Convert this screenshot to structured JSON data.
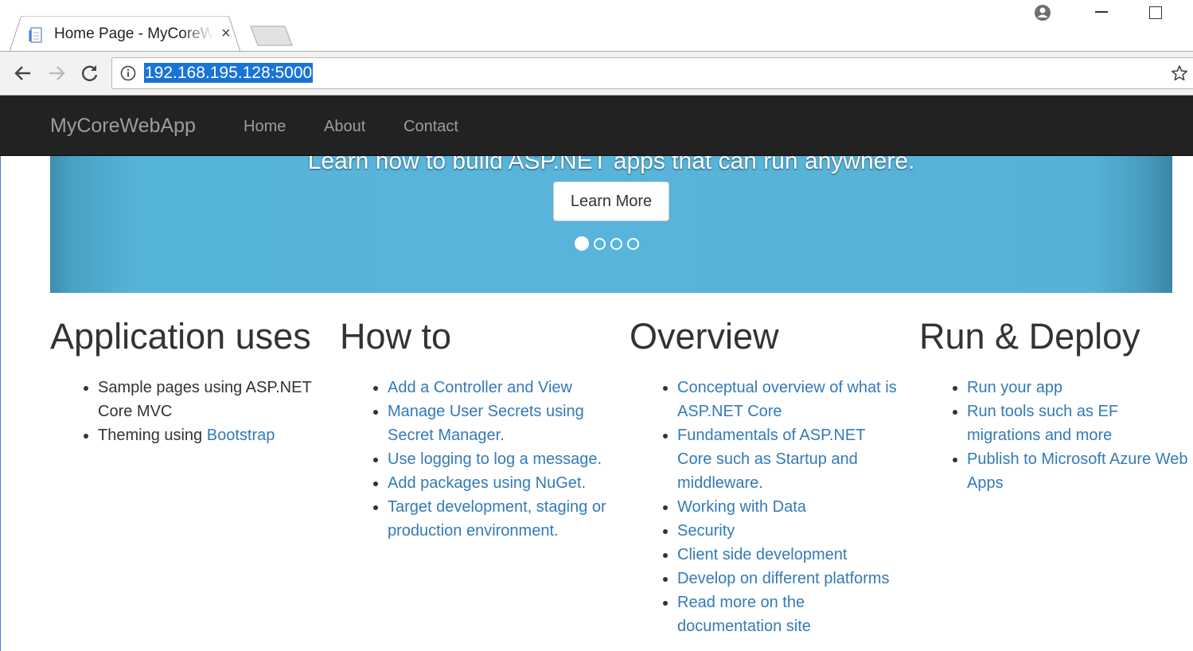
{
  "browser": {
    "tab_title": "Home Page - MyCoreWebApp",
    "tab_close": "×",
    "url": "192.168.195.128:5000",
    "icons": [
      "page-favicon-icon",
      "profile-icon",
      "back-icon",
      "forward-icon",
      "reload-icon",
      "info-icon",
      "star-icon"
    ]
  },
  "navbar": {
    "brand": "MyCoreWebApp",
    "links": [
      "Home",
      "About",
      "Contact"
    ]
  },
  "carousel": {
    "caption": "Learn how to build ASP.NET apps that can run anywhere.",
    "button": "Learn More",
    "slide_count": 4,
    "active_slide": 1
  },
  "columns": [
    {
      "heading": "Application uses",
      "items": [
        {
          "text": "Sample pages using ASP.NET Core MVC"
        },
        {
          "text": "Theming using ",
          "link": "Bootstrap"
        }
      ]
    },
    {
      "heading": "How to",
      "items": [
        {
          "link": "Add a Controller and View"
        },
        {
          "link": "Manage User Secrets using Secret Manager."
        },
        {
          "link": "Use logging to log a message."
        },
        {
          "link": "Add packages using NuGet."
        },
        {
          "link": "Target development, staging or production environment."
        }
      ]
    },
    {
      "heading": "Overview",
      "items": [
        {
          "link": "Conceptual overview of what is ASP.NET Core"
        },
        {
          "link": "Fundamentals of ASP.NET Core such as Startup and middleware."
        },
        {
          "link": "Working with Data"
        },
        {
          "link": "Security"
        },
        {
          "link": "Client side development"
        },
        {
          "link": "Develop on different platforms"
        },
        {
          "link": "Read more on the documentation site"
        }
      ]
    },
    {
      "heading": "Run & Deploy",
      "items": [
        {
          "link": "Run your app"
        },
        {
          "link": "Run tools such as EF migrations and more"
        },
        {
          "link": "Publish to Microsoft Azure Web Apps"
        }
      ]
    }
  ],
  "colors": {
    "navbar_bg": "#222222",
    "nav_text": "#9d9d9d",
    "carousel_bg": "#58b4da",
    "link": "#337ab7",
    "url_highlight": "#1874d5"
  }
}
